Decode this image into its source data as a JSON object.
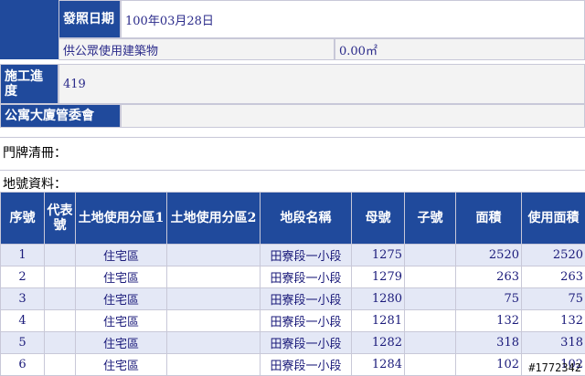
{
  "top": {
    "issue_date_label": "發照日期",
    "issue_date_value": "100年03月28日",
    "public_building_label": "供公眾使用建築物",
    "public_building_value": "0.00㎡",
    "progress_label": "施工進度",
    "progress_value": "419",
    "committee_label": "公寓大廈管委會",
    "committee_value": "",
    "doorplate_label": "門牌清冊：",
    "land_label": "地號資料："
  },
  "table": {
    "headers": [
      "序號",
      "代表號",
      "土地使用分區1",
      "土地使用分區2",
      "地段名稱",
      "母號",
      "子號",
      "面積",
      "使用面積"
    ],
    "rows": [
      [
        "1",
        "",
        "住宅區",
        "",
        "田寮段一小段",
        "1275",
        "",
        "2520",
        "2520"
      ],
      [
        "2",
        "",
        "住宅區",
        "",
        "田寮段一小段",
        "1279",
        "",
        "263",
        "263"
      ],
      [
        "3",
        "",
        "住宅區",
        "",
        "田寮段一小段",
        "1280",
        "",
        "75",
        "75"
      ],
      [
        "4",
        "",
        "住宅區",
        "",
        "田寮段一小段",
        "1281",
        "",
        "132",
        "132"
      ],
      [
        "5",
        "",
        "住宅區",
        "",
        "田寮段一小段",
        "1282",
        "",
        "318",
        "318"
      ],
      [
        "6",
        "",
        "住宅區",
        "",
        "田寮段一小段",
        "1284",
        "",
        "102",
        "102"
      ]
    ]
  },
  "watermark": "#1772342"
}
